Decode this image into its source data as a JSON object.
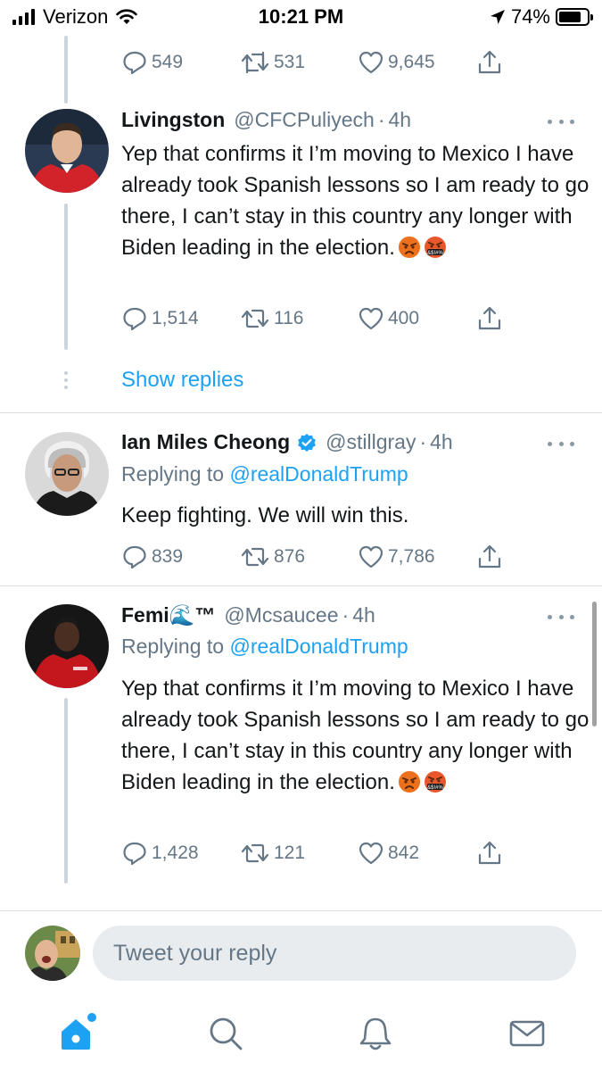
{
  "status_bar": {
    "carrier": "Verizon",
    "time": "10:21 PM",
    "battery_percent": "74%",
    "battery_level": 0.74
  },
  "top_partial_tweet": {
    "replies": "549",
    "retweets": "531",
    "likes": "9,645"
  },
  "tweets": [
    {
      "name": "Livingston",
      "handle": "@CFCPuliyech",
      "time": "4h",
      "text": "Yep that confirms it I’m moving to Mexico I have already took Spanish lessons so I am ready to go there, I can’t stay in this country any longer with Biden leading in the election.",
      "emojis": [
        "pouting-face-emoji",
        "face-with-symbols-emoji"
      ],
      "replies": "1,514",
      "retweets": "116",
      "likes": "400",
      "show_replies": "Show replies"
    },
    {
      "name": "Ian Miles Cheong",
      "verified": true,
      "handle": "@stillgray",
      "time": "4h",
      "replying_prefix": "Replying to",
      "replying_to": "@realDonaldTrump",
      "text": "Keep fighting. We will win this.",
      "replies": "839",
      "retweets": "876",
      "likes": "7,786"
    },
    {
      "name": "Femi🌊™",
      "handle": "@Mcsaucee",
      "time": "4h",
      "replying_prefix": "Replying to",
      "replying_to": "@realDonaldTrump",
      "text": "Yep that confirms it I’m moving to Mexico I have already took Spanish lessons so I am ready to go there, I can’t stay in this country any longer with Biden leading in the election.",
      "emojis": [
        "pouting-face-emoji",
        "face-with-symbols-emoji"
      ],
      "replies": "1,428",
      "retweets": "121",
      "likes": "842"
    }
  ],
  "composer": {
    "placeholder": "Tweet your reply"
  },
  "tabs": [
    "home-icon",
    "search-icon",
    "notifications-icon",
    "messages-icon"
  ],
  "colors": {
    "accent": "#1da1f2",
    "secondary_text": "#657786",
    "primary_text": "#14171a"
  }
}
